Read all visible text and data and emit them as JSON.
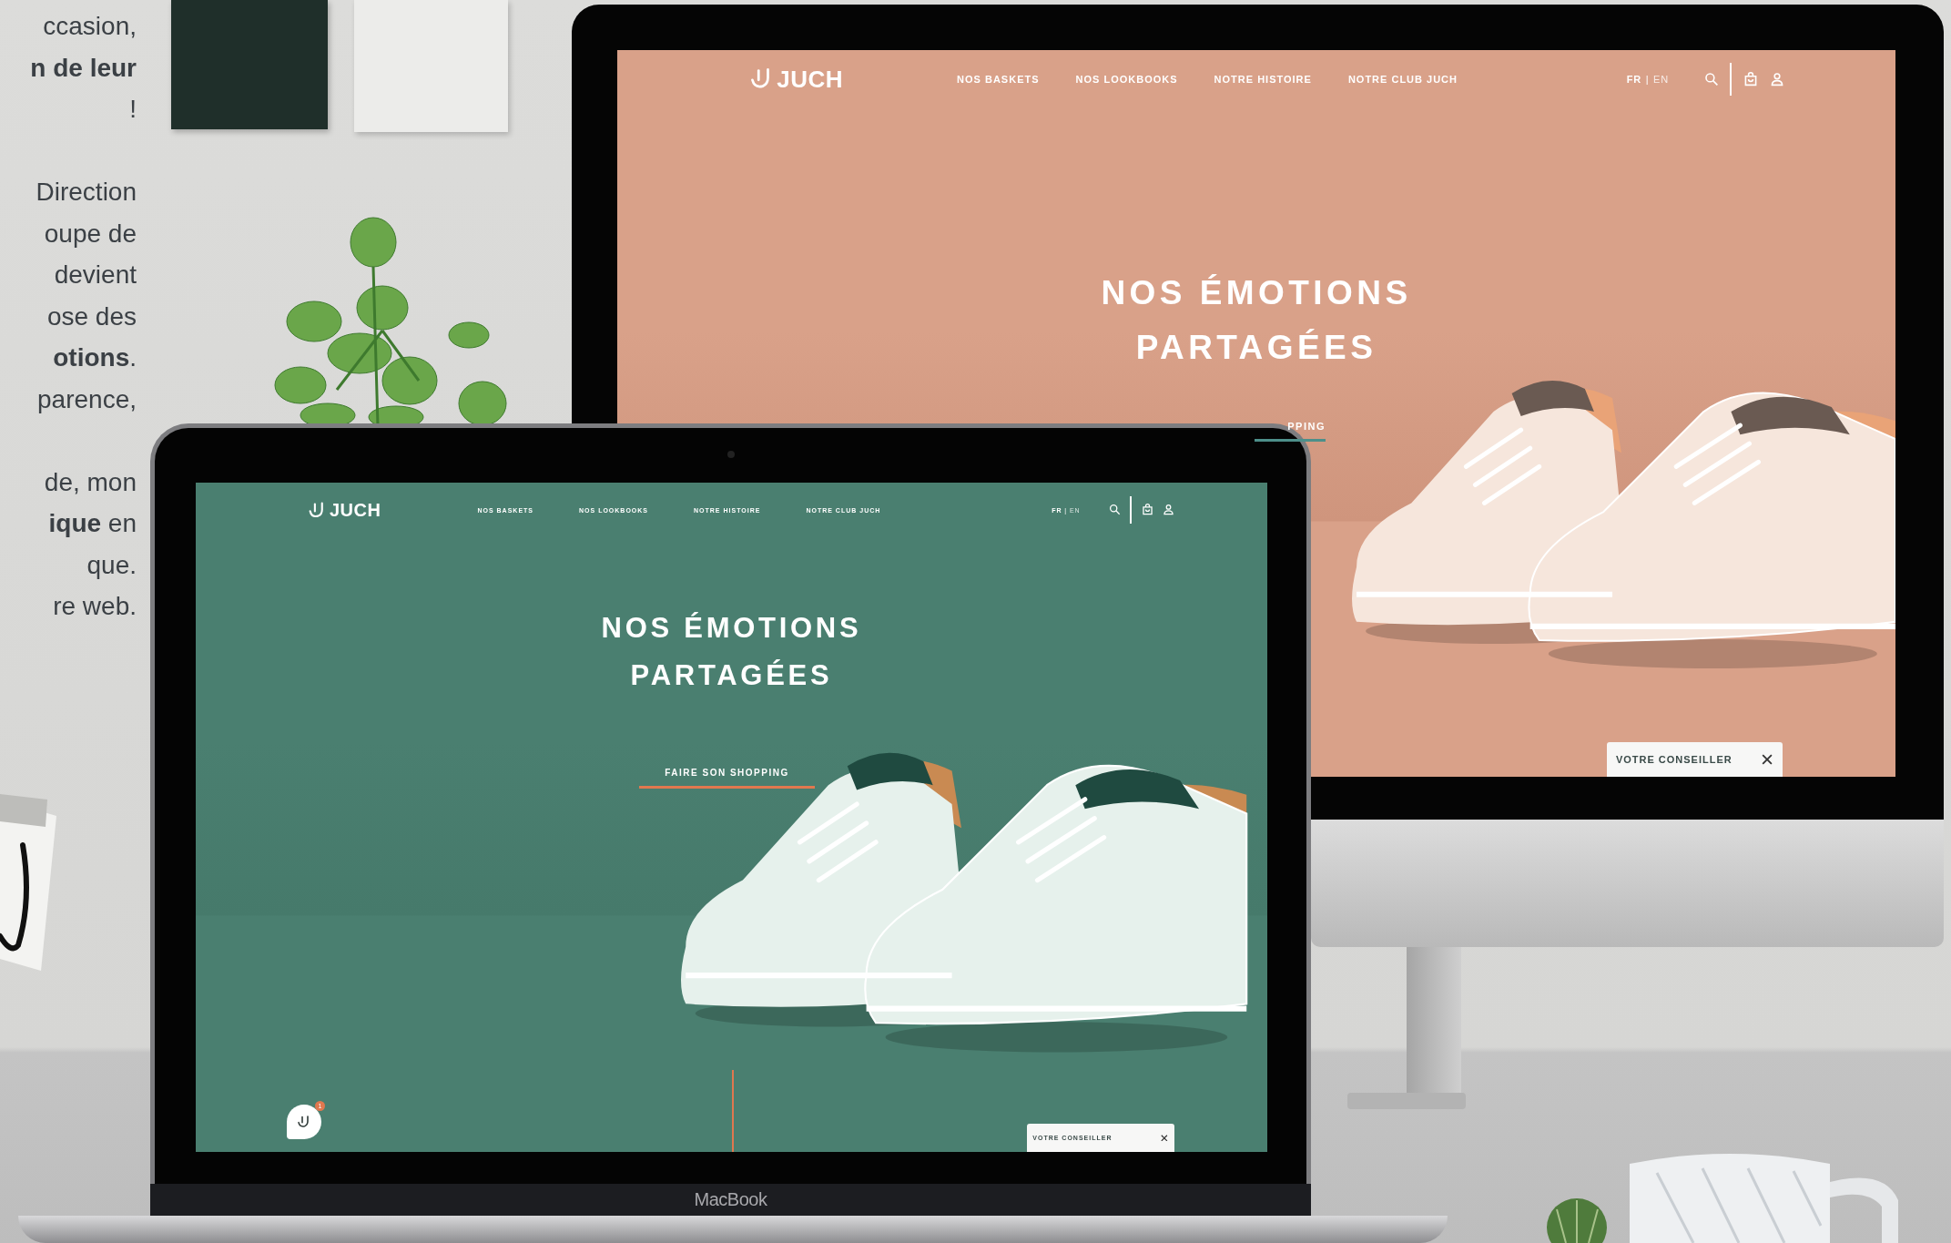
{
  "side_text": {
    "paragraphs": [
      [
        "ccasion,",
        "**n de leur**",
        "!"
      ],
      [
        "Direction",
        "oupe de",
        "devient",
        "ose des",
        "**otions**.",
        "parence,"
      ],
      [
        "de, mon",
        "**ique** en",
        "que.",
        "re web."
      ]
    ]
  },
  "screens": [
    {
      "kind": "monitor",
      "logo": "JUCH",
      "nav": [
        "NOS BASKETS",
        "NOS LOOKBOOKS",
        "NOTRE HISTOIRE",
        "NOTRE CLUB JUCH"
      ],
      "languages": [
        {
          "label": "FR",
          "selected": true
        },
        {
          "label": "EN",
          "selected": false
        }
      ],
      "language_separator": "|",
      "headline": [
        "NOS ÉMOTIONS",
        "PARTAGÉES"
      ],
      "cta": "PPING",
      "advisor": "VOTRE CONSEILLER"
    },
    {
      "kind": "laptop",
      "logo": "JUCH",
      "nav": [
        "NOS BASKETS",
        "NOS LOOKBOOKS",
        "NOTRE HISTOIRE",
        "NOTRE CLUB JUCH"
      ],
      "languages": [
        {
          "label": "FR",
          "selected": true
        },
        {
          "label": "EN",
          "selected": false
        }
      ],
      "language_separator": "|",
      "headline": [
        "NOS ÉMOTIONS",
        "PARTAGÉES"
      ],
      "cta": "FAIRE SON SHOPPING",
      "advisor": "VOTRE CONSEILLER",
      "chat_badge": "1"
    }
  ],
  "laptop_label": "MacBook"
}
